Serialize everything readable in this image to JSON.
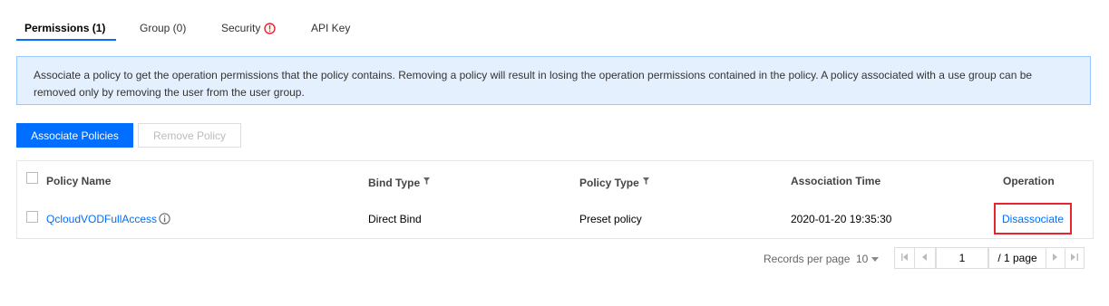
{
  "tabs": [
    {
      "label": "Permissions (1)",
      "active": true
    },
    {
      "label": "Group (0)"
    },
    {
      "label": "Security"
    },
    {
      "label": "API Key"
    }
  ],
  "info_banner": "Associate a policy to get the operation permissions that the policy contains. Removing a policy will result in losing the operation permissions contained in the policy. A policy associated with a use group can be removed only by removing the user from the user group.",
  "toolbar": {
    "associate_label": "Associate Policies",
    "remove_label": "Remove Policy"
  },
  "table": {
    "columns": [
      "Policy Name",
      "Bind Type",
      "Policy Type",
      "Association Time",
      "Operation"
    ],
    "rows": [
      {
        "policy_name": "QcloudVODFullAccess",
        "bind_type": "Direct Bind",
        "policy_type": "Preset policy",
        "association_time": "2020-01-20 19:35:30",
        "operation": "Disassociate"
      }
    ]
  },
  "pagination": {
    "records_per_page_label": "Records per page",
    "records_per_page": "10",
    "current_page": "1",
    "total_label": "/ 1 page"
  },
  "colors": {
    "accent": "#006eff",
    "warning": "#e5252f",
    "banner_bg": "#e5f0ff"
  }
}
